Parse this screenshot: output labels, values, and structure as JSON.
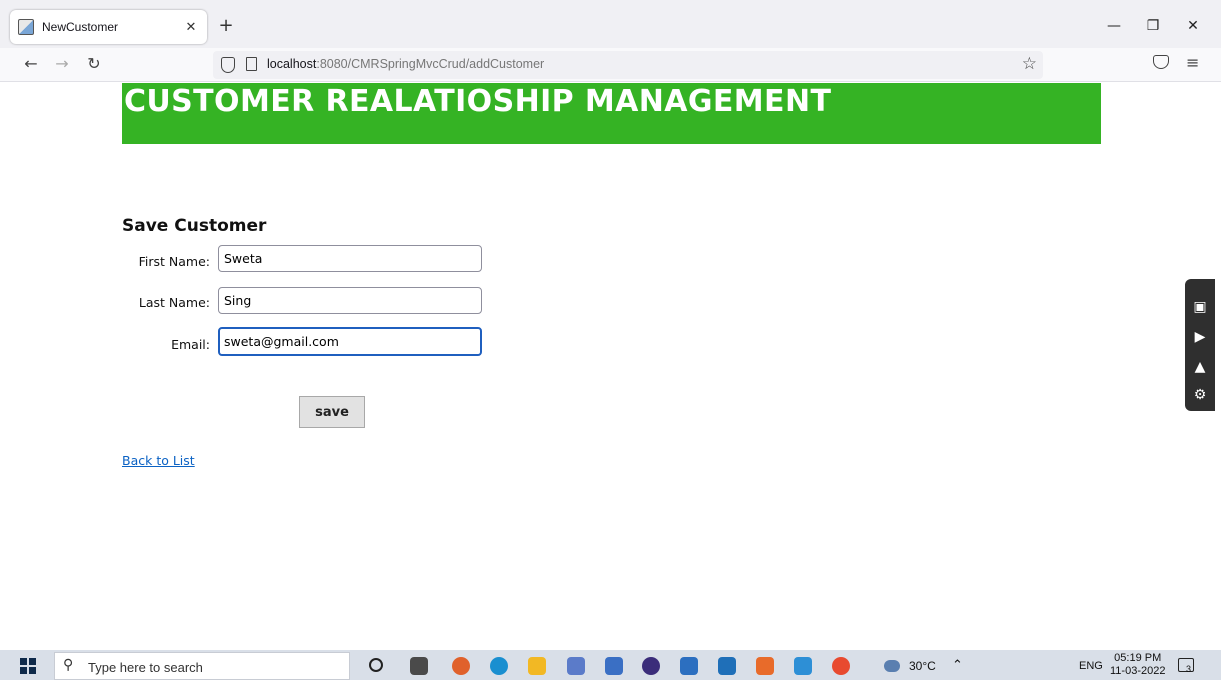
{
  "browser": {
    "tab_title": "NewCustomer",
    "tab_close": "✕",
    "new_tab": "+",
    "url_host": "localhost",
    "url_path": ":8080/CMRSpringMvcCrud/addCustomer",
    "window_minimize": "—",
    "window_restore": "❐",
    "window_close": "✕",
    "back": "←",
    "forward": "→",
    "reload": "↻",
    "bookmark": "☆",
    "menu": "≡"
  },
  "page": {
    "header": "CUSTOMER REALATIOSHIP MANAGEMENT",
    "section_title": "Save Customer",
    "form": {
      "first_name_label": "First Name:",
      "first_name_value": "Sweta",
      "last_name_label": "Last Name:",
      "last_name_value": "Sing",
      "email_label": "Email:",
      "email_value": "sweta@gmail.com",
      "save_label": "save"
    },
    "back_link": "Back to List",
    "header_color": "#35b324"
  },
  "taskbar": {
    "search_placeholder": "Type here to search",
    "weather": "30°C",
    "language": "ENG",
    "time": "05:19 PM",
    "date": "11-03-2022",
    "notification_count": "3"
  },
  "icons": [
    "shield-icon",
    "page-icon",
    "star-icon",
    "pocket-icon",
    "menu-icon",
    "camera-icon",
    "video-icon",
    "gallery-icon",
    "settings-icon",
    "windows-start-icon",
    "search-icon"
  ]
}
